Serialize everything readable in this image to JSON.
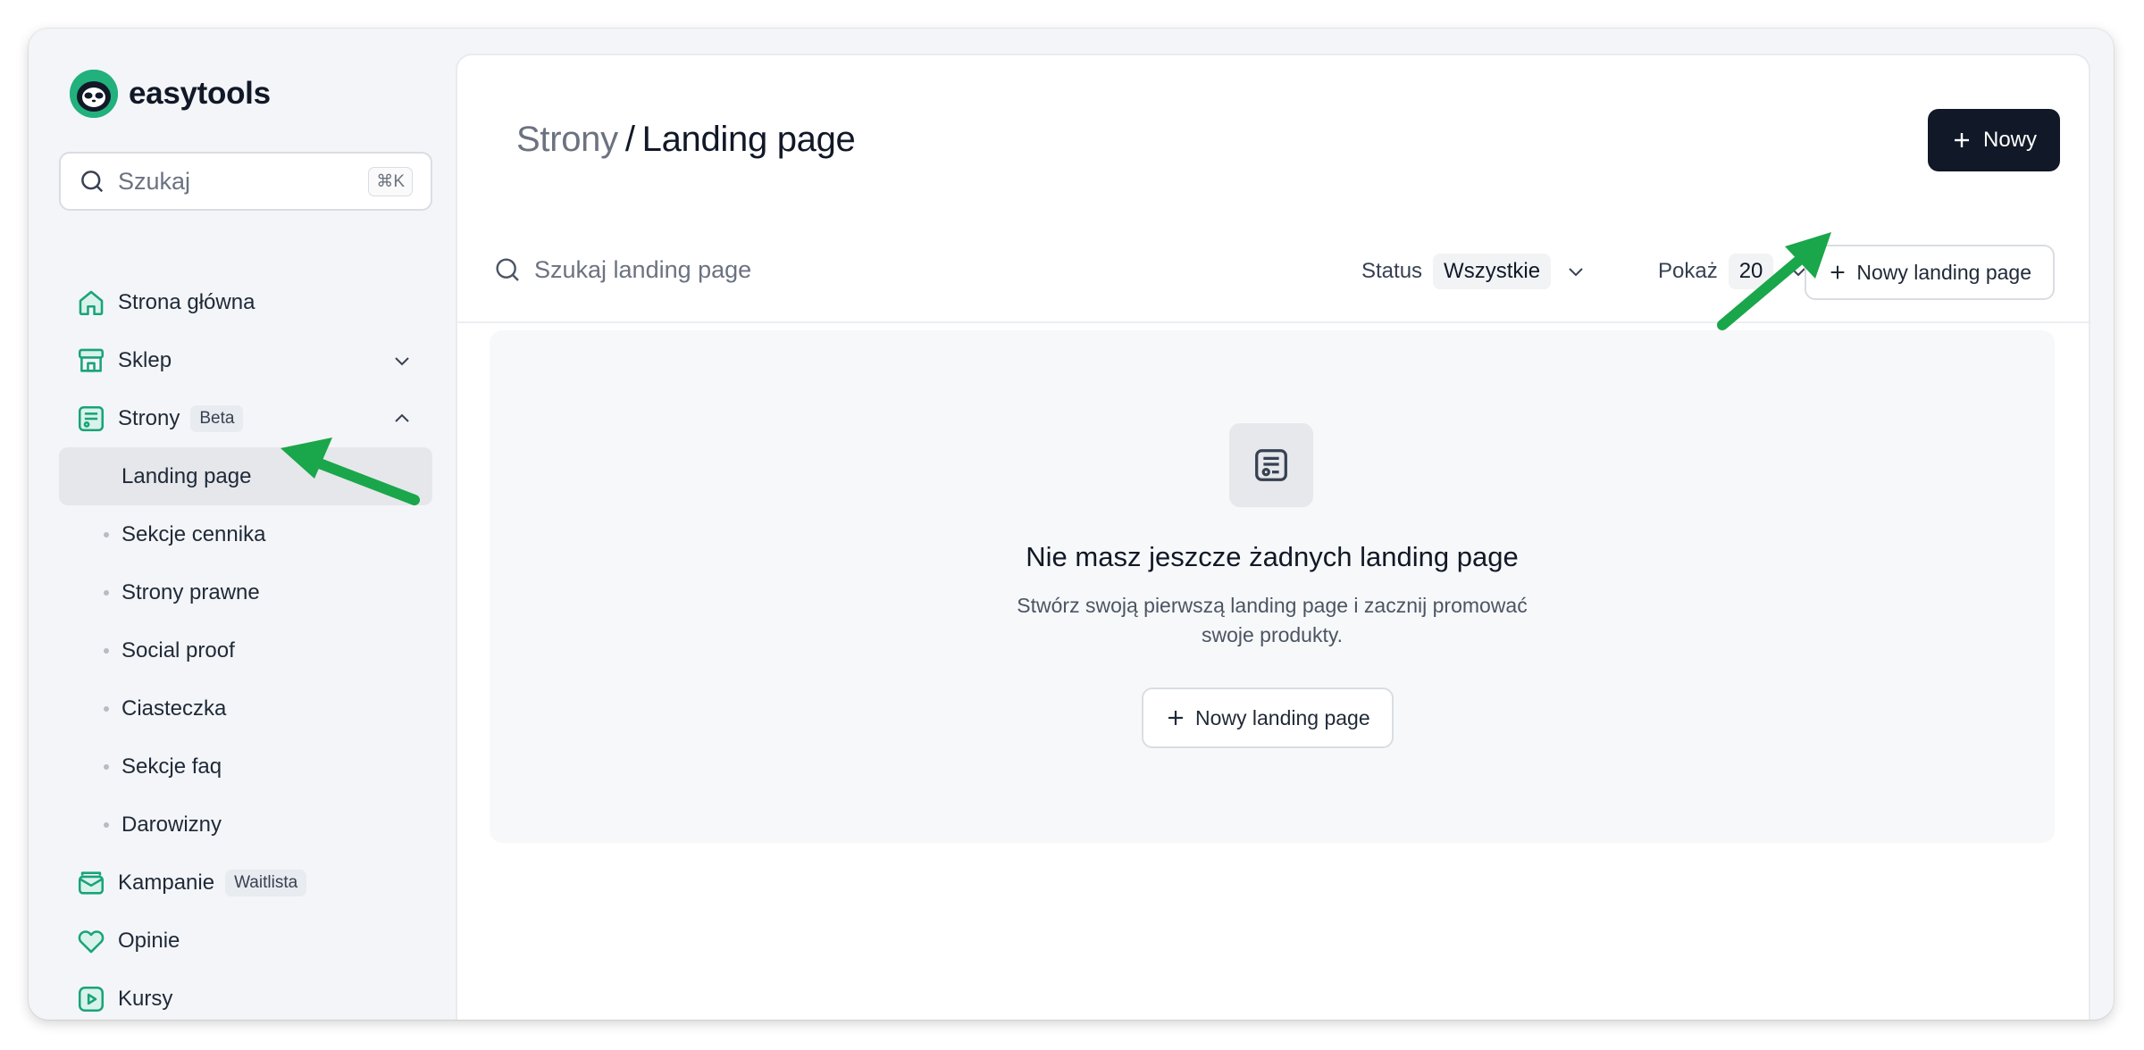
{
  "brand": {
    "name": "easytools"
  },
  "sidebar": {
    "search_placeholder": "Szukaj",
    "search_shortcut": "⌘K",
    "items": [
      {
        "label": "Strona główna",
        "icon": "home-icon"
      },
      {
        "label": "Sklep",
        "icon": "store-icon",
        "expandable": true
      },
      {
        "label": "Strony",
        "icon": "page-icon",
        "badge": "Beta",
        "expanded": true
      },
      {
        "label": "Kampanie",
        "icon": "mail-stack-icon",
        "badge": "Waitlista"
      },
      {
        "label": "Opinie",
        "icon": "heart-icon"
      },
      {
        "label": "Kursy",
        "icon": "play-icon"
      }
    ],
    "subitems": [
      {
        "label": "Landing page",
        "active": true
      },
      {
        "label": "Sekcje cennika"
      },
      {
        "label": "Strony prawne"
      },
      {
        "label": "Social proof"
      },
      {
        "label": "Ciasteczka"
      },
      {
        "label": "Sekcje faq"
      },
      {
        "label": "Darowizny"
      }
    ]
  },
  "header": {
    "breadcrumb_parent": "Strony",
    "breadcrumb_separator": "/",
    "breadcrumb_current": "Landing page",
    "new_button": "Nowy"
  },
  "toolbar": {
    "search_placeholder": "Szukaj landing page",
    "status_label": "Status",
    "status_value": "Wszystkie",
    "show_label": "Pokaż",
    "show_value": "20",
    "new_landing_button": "Nowy landing page"
  },
  "empty_state": {
    "title": "Nie masz jeszcze żadnych landing page",
    "description": "Stwórz swoją pierwszą landing page i zacznij promować swoje produkty.",
    "button": "Nowy landing page"
  },
  "colors": {
    "accent": "#1aa37a",
    "dark_button": "#111827",
    "annotation_arrow": "#1aa64a"
  }
}
